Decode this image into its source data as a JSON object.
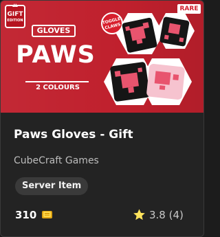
{
  "banner": {
    "gift_line1": "GIFT",
    "gift_line2": "EDITION",
    "category": "GLOVES",
    "product_word": "PAWS",
    "variant": "2 COLOURS",
    "badge": "RARE",
    "sticker": "TOGGLE CLAWS",
    "background_color": "#c0202d"
  },
  "card": {
    "title": "Paws Gloves - Gift",
    "creator": "CubeCraft Games",
    "tag": "Server Item",
    "price": "310",
    "currency_icon": "minecoin-icon",
    "rating": "3.8 (4)",
    "rating_icon": "star-icon"
  }
}
